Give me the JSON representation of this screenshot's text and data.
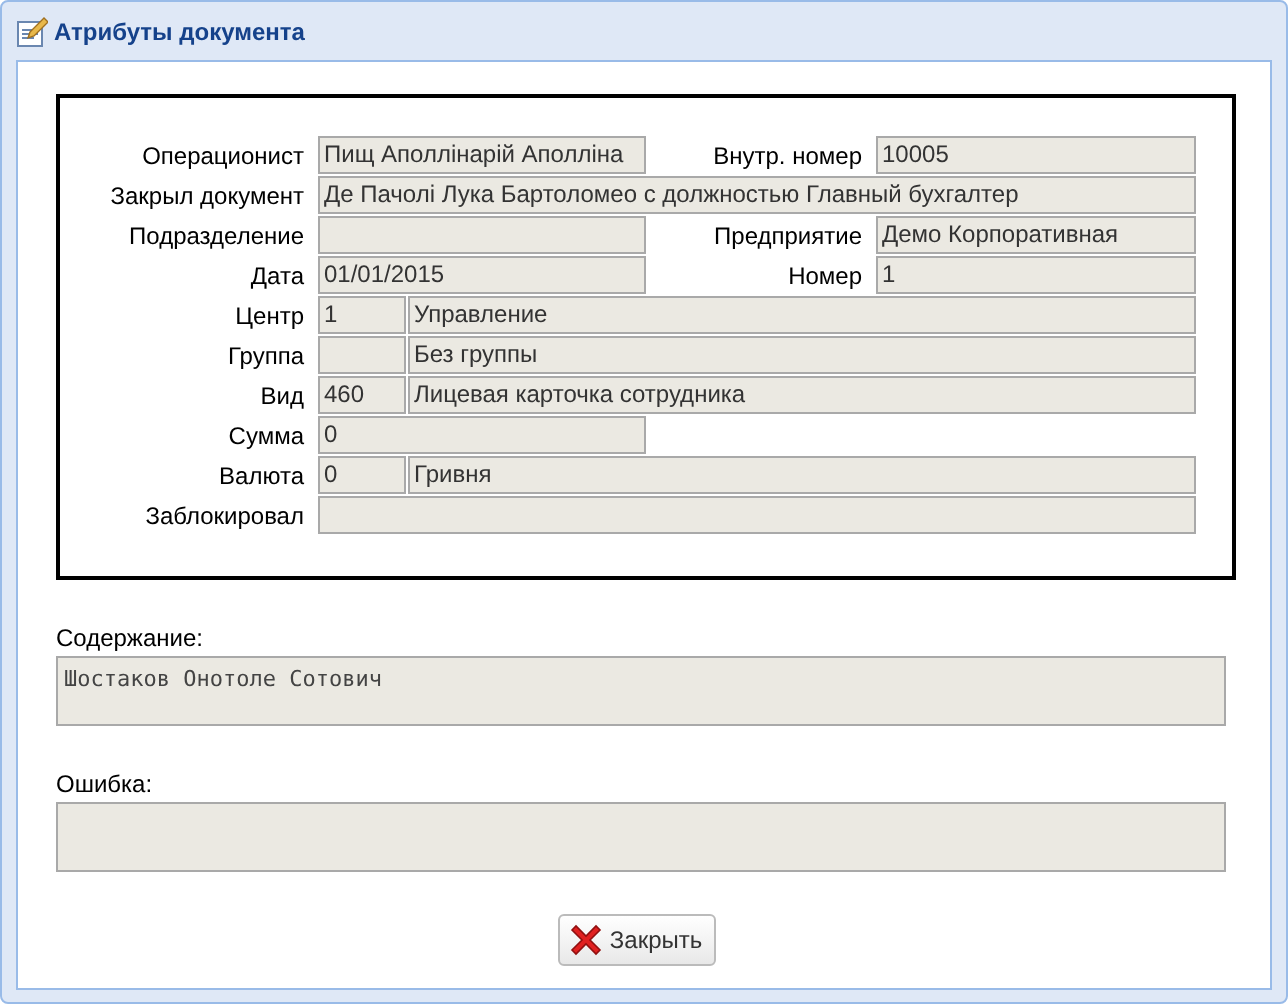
{
  "window": {
    "title": "Атрибуты документа"
  },
  "attributes": [
    {
      "kind": "pair",
      "label": "Операционист",
      "value": "Пищ Аполлінарій Аполліна",
      "right_label": "Внутр. номер",
      "right_value": "10005"
    },
    {
      "kind": "wide",
      "label": "Закрыл документ",
      "value": "Де Пачолі Лука Бартоломео с должностью Главный бухгалтер"
    },
    {
      "kind": "pair",
      "label": "Подразделение",
      "right_label": "Предприятие",
      "right_value": "Демо Корпоративная"
    },
    {
      "kind": "pair",
      "label": "Дата",
      "value": "01/01/2015",
      "right_label": "Номер",
      "right_value": "1"
    },
    {
      "kind": "coded",
      "label": "Центр",
      "code": "1",
      "value": "Управление"
    },
    {
      "kind": "coded",
      "label": "Группа",
      "value": "Без группы"
    },
    {
      "kind": "coded",
      "label": "Вид",
      "code": "460",
      "value": "Лицевая карточка сотрудника"
    },
    {
      "kind": "half",
      "label": "Сумма",
      "value": "0"
    },
    {
      "kind": "coded",
      "label": "Валюта",
      "code": "0",
      "value": "Гривня"
    },
    {
      "kind": "wide",
      "label": "Заблокировал"
    }
  ],
  "content": {
    "label": "Содержание:",
    "value": "Шостаков Онотоле Сотович"
  },
  "error": {
    "label": "Ошибка:"
  },
  "buttons": [
    {
      "label": "Закрыть"
    }
  ]
}
